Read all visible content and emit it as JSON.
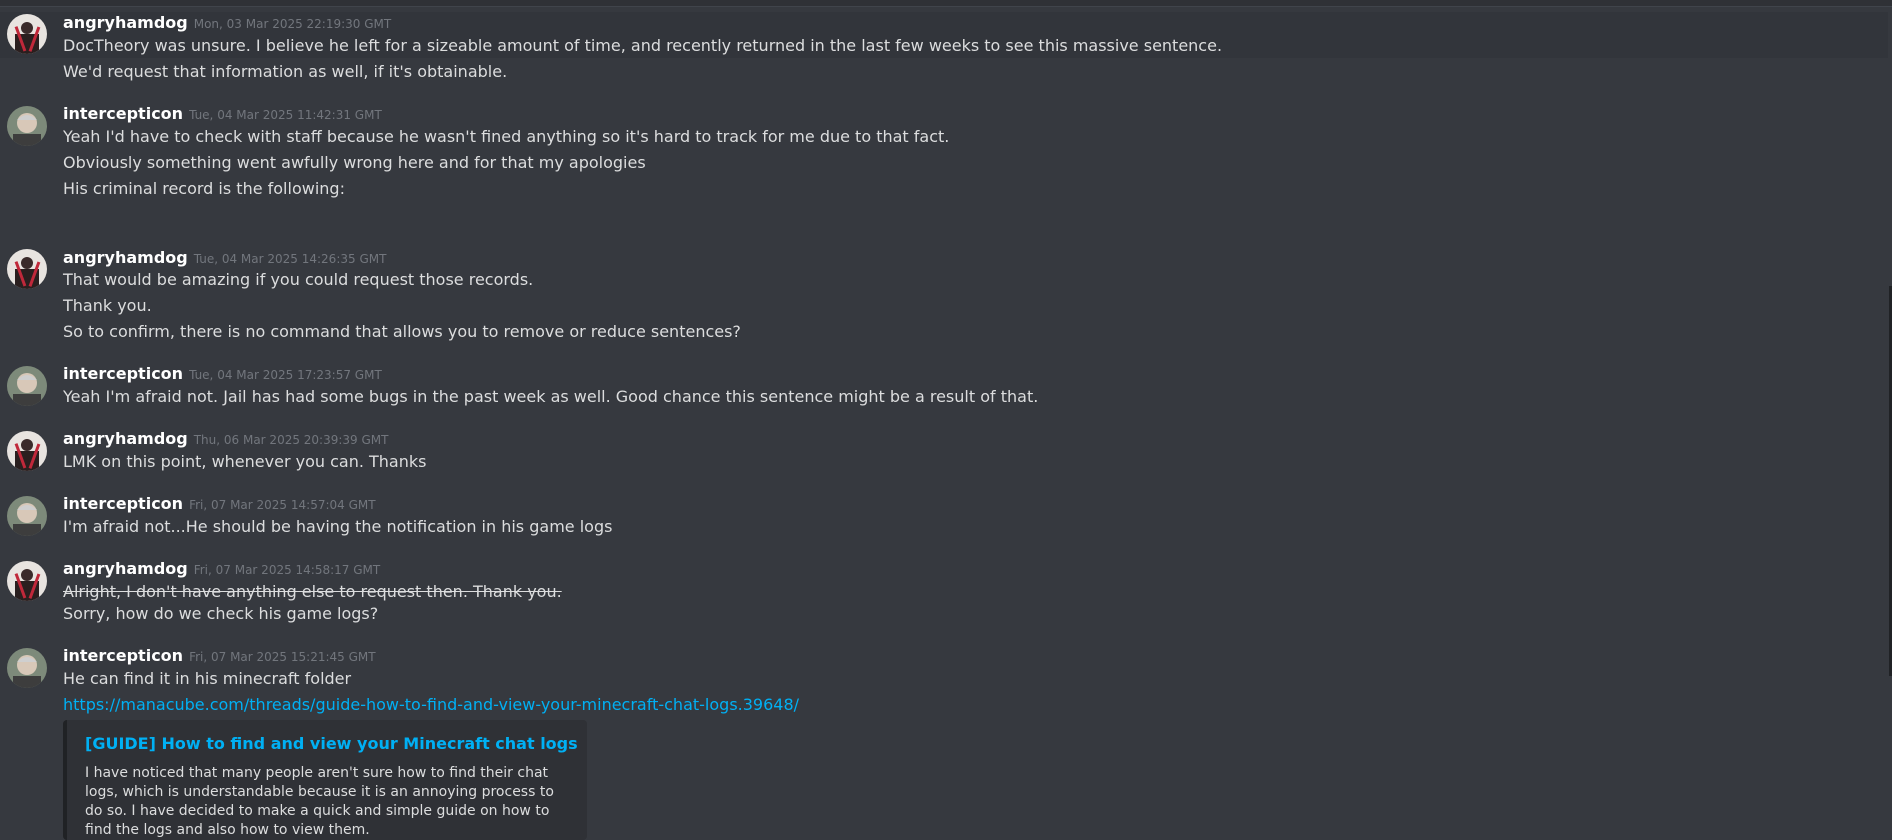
{
  "messages": [
    {
      "user": "angryhamdog",
      "timestamp": "Mon, 03 Mar 2025 22:19:30 GMT",
      "lines": [
        "DocTheory was unsure. I believe he left for a sizeable amount of time, and recently returned in the last few weeks to see this massive sentence.",
        "We'd request that information as well, if it's obtainable."
      ]
    },
    {
      "user": "intercepticon",
      "timestamp": "Tue, 04 Mar 2025 11:42:31 GMT",
      "lines": [
        "Yeah I'd have to check with staff because he wasn't fined anything so it's hard to track for me due to that fact.",
        "Obviously something went awfully wrong here and for that my apologies",
        "His criminal record is the following:"
      ]
    },
    {
      "user": "angryhamdog",
      "timestamp": "Tue, 04 Mar 2025 14:26:35 GMT",
      "lines": [
        "That would be amazing if you could request those records.",
        "Thank you.",
        "So to confirm, there is no command that allows you to remove or reduce sentences?"
      ]
    },
    {
      "user": "intercepticon",
      "timestamp": "Tue, 04 Mar 2025 17:23:57 GMT",
      "lines": [
        "Yeah I'm afraid not. Jail has had some bugs in the past week as well. Good chance this sentence might be a result of that."
      ]
    },
    {
      "user": "angryhamdog",
      "timestamp": "Thu, 06 Mar 2025 20:39:39 GMT",
      "lines": [
        "LMK on this point, whenever you can. Thanks"
      ]
    },
    {
      "user": "intercepticon",
      "timestamp": "Fri, 07 Mar 2025 14:57:04 GMT",
      "lines": [
        "I'm afraid not...He should be having the notification in his game logs"
      ]
    },
    {
      "user": "angryhamdog",
      "timestamp": "Fri, 07 Mar 2025 14:58:17 GMT",
      "lines": [
        "Alright, I don't have anything else to request then. Thank you.",
        "Sorry, how do we check his game logs?"
      ]
    },
    {
      "user": "intercepticon",
      "timestamp": "Fri, 07 Mar 2025 15:21:45 GMT",
      "lines": [
        "He can find it in his minecraft folder",
        "https://manacube.com/threads/guide-how-to-find-and-view-your-minecraft-chat-logs.39648/"
      ]
    }
  ],
  "embed": {
    "title": "[GUIDE] How to find and view your Minecraft chat logs",
    "description": "I have noticed that many people aren't sure how to find their chat logs, which is understandable because it is an annoying process to do so. I have decided to make a quick and simple guide on how to find the logs and also how to view them."
  },
  "colors": {
    "background": "#36393f",
    "link": "#00b0f4",
    "username": "#ffffff",
    "text": "#dcddde",
    "timestamp": "#72767d"
  },
  "icons": {
    "angryhamdog_avatar": "avatar-red-figure-icon",
    "intercepticon_avatar": "avatar-portrait-icon"
  }
}
